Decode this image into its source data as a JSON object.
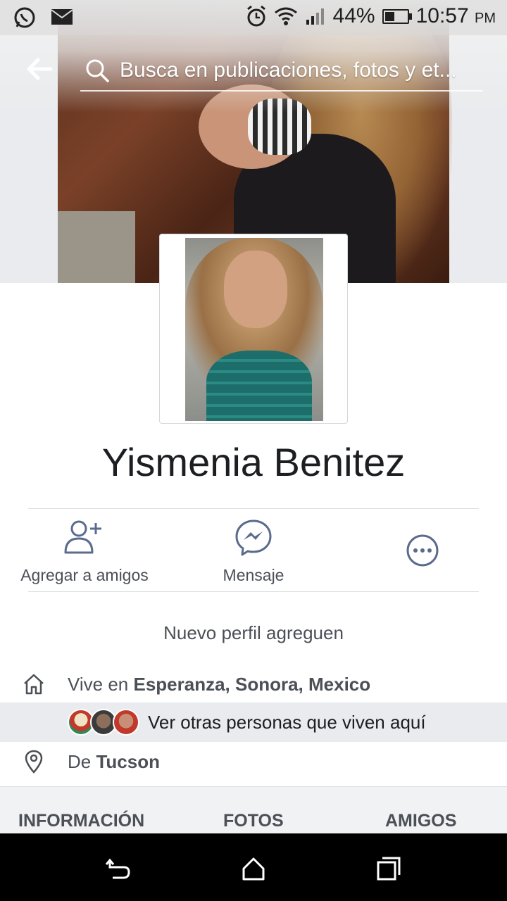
{
  "status_bar": {
    "left_icons": [
      "whatsapp-icon",
      "mail-icon"
    ],
    "right_icons": [
      "alarm-icon",
      "wifi-icon",
      "signal-icon",
      "battery-icon"
    ],
    "battery_percent": "44%",
    "battery_level": 0.44,
    "time": "10:57",
    "ampm": "PM"
  },
  "search": {
    "placeholder": "Busca en publicaciones, fotos y et..."
  },
  "profile": {
    "name": "Yismenia Benitez",
    "bio": "Nuevo perfil agreguen"
  },
  "actions": [
    {
      "label": "Agregar a amigos",
      "icon": "add-friend-icon"
    },
    {
      "label": "Mensaje",
      "icon": "messenger-icon"
    },
    {
      "label": "",
      "icon": "more-icon"
    }
  ],
  "info": {
    "lives_prefix": "Vive en ",
    "lives_place": "Esperanza, Sonora, Mexico",
    "others_text": "Ver otras personas que viven aquí",
    "from_prefix": "De ",
    "from_place": "Tucson"
  },
  "tabs": [
    "INFORMACIÓN",
    "FOTOS",
    "AMIGOS"
  ],
  "colors": {
    "text_primary": "#1c1e21",
    "text_secondary": "#4b4f56",
    "divider": "#dddfe2",
    "highlight_row": "#e9ebee"
  }
}
